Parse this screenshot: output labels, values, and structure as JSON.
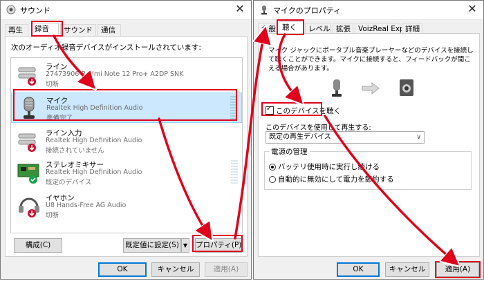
{
  "left": {
    "title": "サウンド",
    "tabs": [
      "再生",
      "録音",
      "サウンド",
      "通信"
    ],
    "instruction": "次のオーディオ録音デバイスがインストールされています:",
    "devices": [
      {
        "name": "ライン",
        "desc": "27473906-Redmi Note 12 Pro+ A2DP SNK",
        "status": "切断",
        "icon": "line-in-jack-icon"
      },
      {
        "name": "マイク",
        "desc": "Realtek High Definition Audio",
        "status": "準備完了",
        "icon": "microphone-icon"
      },
      {
        "name": "ライン入力",
        "desc": "Realtek High Definition Audio",
        "status": "接続されていません",
        "icon": "line-in-jack-icon"
      },
      {
        "name": "ステレオミキサー",
        "desc": "Realtek High Definition Audio",
        "status": "既定のデバイス",
        "icon": "sound-card-icon"
      },
      {
        "name": "イヤホン",
        "desc": "U8 Hands-Free AG Audio",
        "status": "切断",
        "icon": "headset-icon"
      }
    ],
    "buttons": {
      "configure": "構成(C)",
      "set_default": "既定値に設定(S)",
      "properties": "プロパティ(P)",
      "ok": "OK",
      "cancel": "キャンセル",
      "apply": "適用(A)"
    }
  },
  "right": {
    "title": "マイクのプロパティ",
    "tabs": [
      "全般",
      "聴く",
      "レベル",
      "拡張",
      "VoizReal Exp",
      "詳細"
    ],
    "description": "マイク ジャックにポータブル音楽プレーヤーなどのデバイスを接続して聴くことができます。マイクに接続すると、フィードバックが聞こえる場合があります。",
    "listen_checkbox": "このデバイスを聴く",
    "playback_label": "このデバイスを使用して再生する:",
    "playback_value": "既定の再生デバイス",
    "power_group": "電源の管理",
    "radio_battery": "バッテリ使用時に実行し続ける",
    "radio_auto": "自動的に無効にして電力を節約する",
    "buttons": {
      "ok": "OK",
      "cancel": "キャンセル",
      "apply": "適用(A)"
    }
  },
  "colors": {
    "highlight": "#e0001b",
    "selection": "#cce8ff",
    "accent": "#0078d7"
  }
}
